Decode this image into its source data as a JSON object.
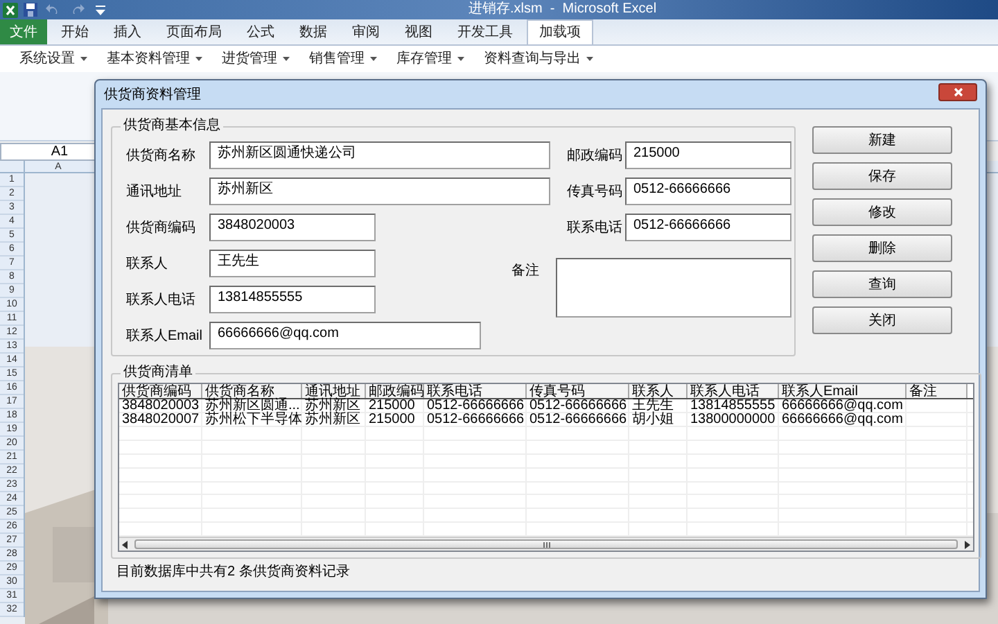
{
  "window": {
    "title": "进销存.xlsm  -  Microsoft Excel"
  },
  "ribbon_tabs": [
    {
      "label": "文件",
      "kind": "file",
      "selected": false
    },
    {
      "label": "开始",
      "kind": "tab",
      "selected": false
    },
    {
      "label": "插入",
      "kind": "tab",
      "selected": false
    },
    {
      "label": "页面布局",
      "kind": "tab",
      "selected": false
    },
    {
      "label": "公式",
      "kind": "tab",
      "selected": false
    },
    {
      "label": "数据",
      "kind": "tab",
      "selected": false
    },
    {
      "label": "审阅",
      "kind": "tab",
      "selected": false
    },
    {
      "label": "视图",
      "kind": "tab",
      "selected": false
    },
    {
      "label": "开发工具",
      "kind": "tab",
      "selected": false
    },
    {
      "label": "加载项",
      "kind": "tab",
      "selected": true
    }
  ],
  "addin_menus": [
    "系统设置",
    "基本资料管理",
    "进货管理",
    "销售管理",
    "库存管理",
    "资料查询与导出"
  ],
  "sheet": {
    "name_box": "A1",
    "column_header": "A",
    "row_numbers": [
      "1",
      "2",
      "3",
      "4",
      "5",
      "6",
      "7",
      "8",
      "9",
      "10",
      "11",
      "12",
      "13",
      "14",
      "15",
      "16",
      "17",
      "18",
      "19",
      "20",
      "21",
      "22",
      "23",
      "24",
      "25",
      "26",
      "27",
      "28",
      "29",
      "30",
      "31",
      "32"
    ]
  },
  "dialog": {
    "title": "供货商资料管理",
    "basic_info": {
      "title": "供货商基本信息",
      "left_fields": [
        {
          "label": "供货商名称",
          "value": "苏州新区圆通快递公司"
        },
        {
          "label": "通讯地址",
          "value": "苏州新区"
        },
        {
          "label": "供货商编码",
          "value": "3848020003"
        },
        {
          "label": "联系人",
          "value": "王先生"
        },
        {
          "label": "联系人电话",
          "value": "13814855555"
        },
        {
          "label": "联系人Email",
          "value": "66666666@qq.com"
        }
      ],
      "right_fields": [
        {
          "label": "邮政编码",
          "value": "215000"
        },
        {
          "label": "传真号码",
          "value": "0512-66666666"
        },
        {
          "label": "联系电话",
          "value": "0512-66666666"
        }
      ],
      "remark": {
        "label": "备注"
      }
    },
    "buttons": [
      "新建",
      "保存",
      "修改",
      "删除",
      "查询",
      "关闭"
    ],
    "list": {
      "title": "供货商清单",
      "columns": [
        "供货商编码",
        "供货商名称",
        "通讯地址",
        "邮政编码",
        "联系电话",
        "传真号码",
        "联系人",
        "联系人电话",
        "联系人Email",
        "备注"
      ],
      "rows": [
        [
          "3848020003",
          "苏州新区圆通...",
          "苏州新区",
          "215000",
          "0512-66666666",
          "0512-66666666",
          "王先生",
          "13814855555",
          "66666666@qq.com"
        ],
        [
          "3848020007",
          "苏州松下半导体",
          "苏州新区",
          "215000",
          "0512-66666666",
          "0512-66666666",
          "胡小姐",
          "13800000000",
          "66666666@qq.com"
        ]
      ]
    },
    "status": "目前数据库中共有2 条供货商资料记录"
  }
}
